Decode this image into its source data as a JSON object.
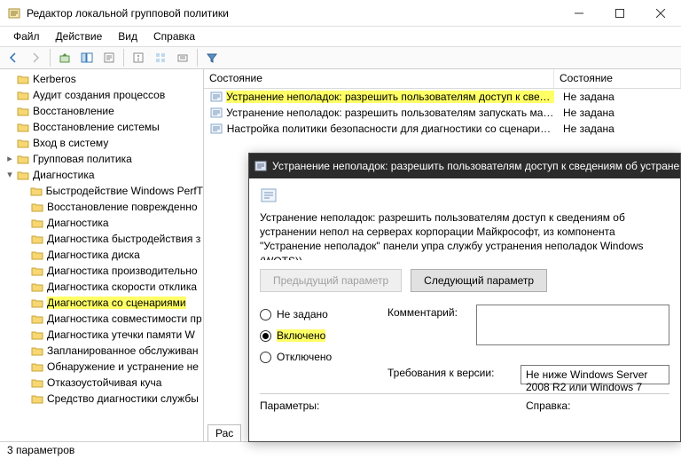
{
  "window": {
    "title": "Редактор локальной групповой политики"
  },
  "menu": {
    "file": "Файл",
    "action": "Действие",
    "view": "Вид",
    "help": "Справка"
  },
  "tree": {
    "items": [
      {
        "indent": 0,
        "exp": "",
        "label": "Kerberos"
      },
      {
        "indent": 0,
        "exp": "",
        "label": "Аудит создания процессов"
      },
      {
        "indent": 0,
        "exp": "",
        "label": "Восстановление"
      },
      {
        "indent": 0,
        "exp": "",
        "label": "Восстановление системы"
      },
      {
        "indent": 0,
        "exp": "",
        "label": "Вход в систему"
      },
      {
        "indent": 0,
        "exp": "▸",
        "label": "Групповая политика"
      },
      {
        "indent": 0,
        "exp": "▾",
        "label": "Диагностика"
      },
      {
        "indent": 1,
        "exp": "",
        "label": "Быстродействие Windows PerfT"
      },
      {
        "indent": 1,
        "exp": "",
        "label": "Восстановление поврежденно"
      },
      {
        "indent": 1,
        "exp": "",
        "label": "Диагностика"
      },
      {
        "indent": 1,
        "exp": "",
        "label": "Диагностика быстродействия з"
      },
      {
        "indent": 1,
        "exp": "",
        "label": "Диагностика диска"
      },
      {
        "indent": 1,
        "exp": "",
        "label": "Диагностика производительно"
      },
      {
        "indent": 1,
        "exp": "",
        "label": "Диагностика скорости отклика"
      },
      {
        "indent": 1,
        "exp": "",
        "label": "Диагностика со сценариями",
        "hilite": true
      },
      {
        "indent": 1,
        "exp": "",
        "label": "Диагностика совместимости пр"
      },
      {
        "indent": 1,
        "exp": "",
        "label": "Диагностика утечки памяти W"
      },
      {
        "indent": 1,
        "exp": "",
        "label": "Запланированное обслуживан"
      },
      {
        "indent": 1,
        "exp": "",
        "label": "Обнаружение и устранение не"
      },
      {
        "indent": 1,
        "exp": "",
        "label": "Отказоустойчивая куча"
      },
      {
        "indent": 1,
        "exp": "",
        "label": "Средство диагностики службы"
      }
    ]
  },
  "list": {
    "header": {
      "name": "Состояние",
      "state": "Состояние"
    },
    "rows": [
      {
        "name": "Устранение неполадок: разрешить пользователям доступ к сведени...",
        "state": "Не задана",
        "sel": true
      },
      {
        "name": "Устранение неполадок: разрешить пользователям запускать мастер...",
        "state": "Не задана",
        "sel": false
      },
      {
        "name": "Настройка политики безопасности для диагностики со сценариями",
        "state": "Не задана",
        "sel": false
      }
    ]
  },
  "dialog": {
    "title": "Устранение неполадок: разрешить пользователям доступ к сведениям об устранении неп",
    "desc": "Устранение неполадок: разрешить пользователям доступ к сведениям об устранении непол на серверах корпорации Майкрософт, из компонента \"Устранение неполадок\" панели упра службу устранения неполадок Windows (WOTS))",
    "prev": "Предыдущий параметр",
    "next": "Следующий параметр",
    "opt_not": "Не задано",
    "opt_on": "Включено",
    "opt_off": "Отключено",
    "comment_label": "Комментарий:",
    "req_label": "Требования к версии:",
    "req_value": "Не ниже Windows Server 2008 R2 или Windows 7",
    "params_label": "Параметры:",
    "help_label": "Справка:"
  },
  "tabs": {
    "ext": "Рас"
  },
  "status": "3 параметров"
}
